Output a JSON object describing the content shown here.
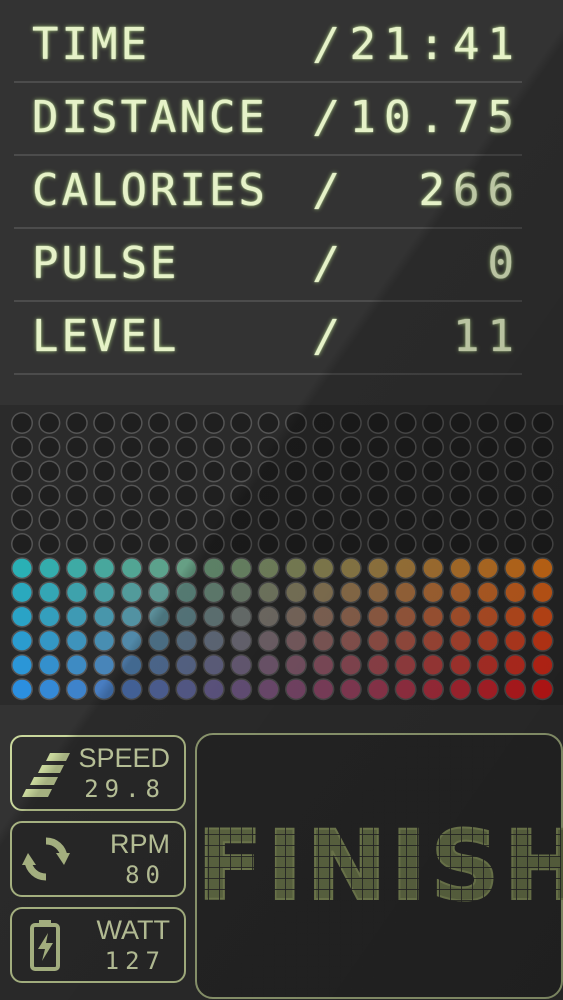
{
  "stats": [
    {
      "label": "TIME",
      "slash": "/",
      "value": "21:41"
    },
    {
      "label": "DISTANCE",
      "slash": "/",
      "value": "10.75"
    },
    {
      "label": "CALORIES",
      "slash": "/",
      "value": "266"
    },
    {
      "label": "PULSE",
      "slash": "/",
      "value": "0"
    },
    {
      "label": "LEVEL",
      "slash": "/",
      "value": "11"
    }
  ],
  "level_meter": {
    "columns": 20,
    "rows": 12,
    "lit_rows": 6,
    "colors": {
      "unlit": "#1f1f1f",
      "unlit_ring": "#555555",
      "left_bottom": "#2b8fe0",
      "left_top": "#2ab0b5",
      "right_bottom": "#e01a1a",
      "right_top": "#e87a1a",
      "mid": "#8a6a9a"
    }
  },
  "cards": [
    {
      "label": "SPEED",
      "value": "29.8",
      "icon": "speed-icon"
    },
    {
      "label": "RPM",
      "value": "80",
      "icon": "refresh-icon"
    },
    {
      "label": "WATT",
      "value": "127",
      "icon": "battery-icon"
    }
  ],
  "finish_button": {
    "label": "FINISH",
    "color": "#6f7a4f"
  },
  "accent": "#c9d79c"
}
